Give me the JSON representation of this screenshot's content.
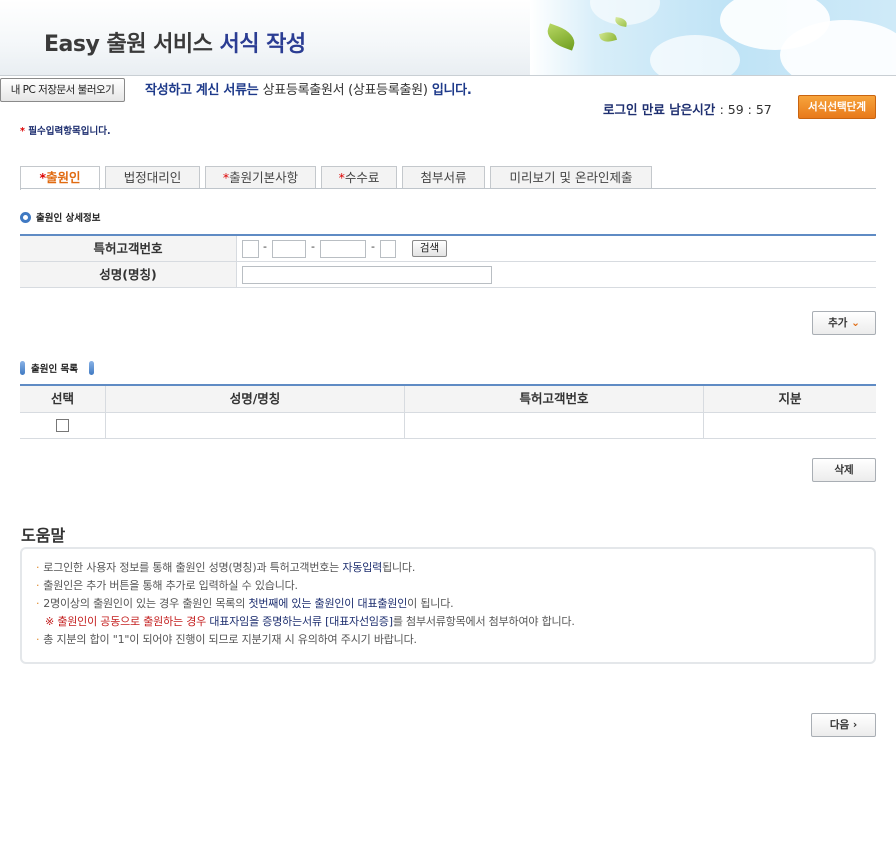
{
  "header": {
    "title_prefix": "Easy 출원 서비스",
    "title_highlight": "서식 작성"
  },
  "toolbar": {
    "load_button": "내 PC 저장문서 불러오기",
    "doc_prefix": "작성하고 계신 서류는",
    "doc_name": "상표등록출원서 (상표등록출원)",
    "doc_suffix": "입니다.",
    "login_label": "로그인 만료 남은시간",
    "login_time": ": 59 : 57",
    "stage_button": "서식선택단계"
  },
  "required_note": {
    "star": "*",
    "text": "필수입력항목입니다."
  },
  "tabs": [
    {
      "star": "*",
      "label": "출원인",
      "active": true
    },
    {
      "star": "",
      "label": "법정대리인",
      "active": false
    },
    {
      "star": "*",
      "label": "출원기본사항",
      "active": false
    },
    {
      "star": "*",
      "label": "수수료",
      "active": false
    },
    {
      "star": "",
      "label": "첨부서류",
      "active": false
    },
    {
      "star": "",
      "label": "미리보기 및 온라인제출",
      "active": false
    }
  ],
  "detail_section": {
    "title": "출원인 상세정보",
    "customer_no_label": "특허고객번호",
    "name_label": "성명(명칭)",
    "dash": "-",
    "search_button": "검색",
    "add_button": "추가"
  },
  "list_section": {
    "title": "출원인 목록",
    "columns": [
      "선택",
      "성명/명칭",
      "특허고객번호",
      "지분"
    ],
    "rows": [
      {
        "name": "",
        "customer_no": "",
        "share": ""
      }
    ],
    "delete_button": "삭제"
  },
  "help": {
    "title": "도움말",
    "line1_a": "로그인한 사용자 정보를 통해 출원인 성명(명칭)과 특허고객번호는 ",
    "line1_b": "자동입력",
    "line1_c": "됩니다.",
    "line2": "출원인은 추가 버튼을 통해 추가로 입력하실 수 있습니다.",
    "line3_a": "2명이상의 출원인이 있는 경우 출원인 목록의 ",
    "line3_b": "첫번째에 있는 출원인이 대표출원인",
    "line3_c": "이 됩니다.",
    "line4_a": "※ 출원인이 공동으로 출원하는 경우 ",
    "line4_b": "대표자임을 증명하는서류 [대표자선임증]",
    "line4_c": "를 첨부서류항목에서 첨부하여야 합니다.",
    "line5": "총 지분의 합이 \"1\"이 되어야 진행이 되므로 지분기재 시 유의하여 주시기 바랍니다."
  },
  "footer": {
    "next_button": "다음",
    "next_icon": "chevron-right-icon"
  }
}
